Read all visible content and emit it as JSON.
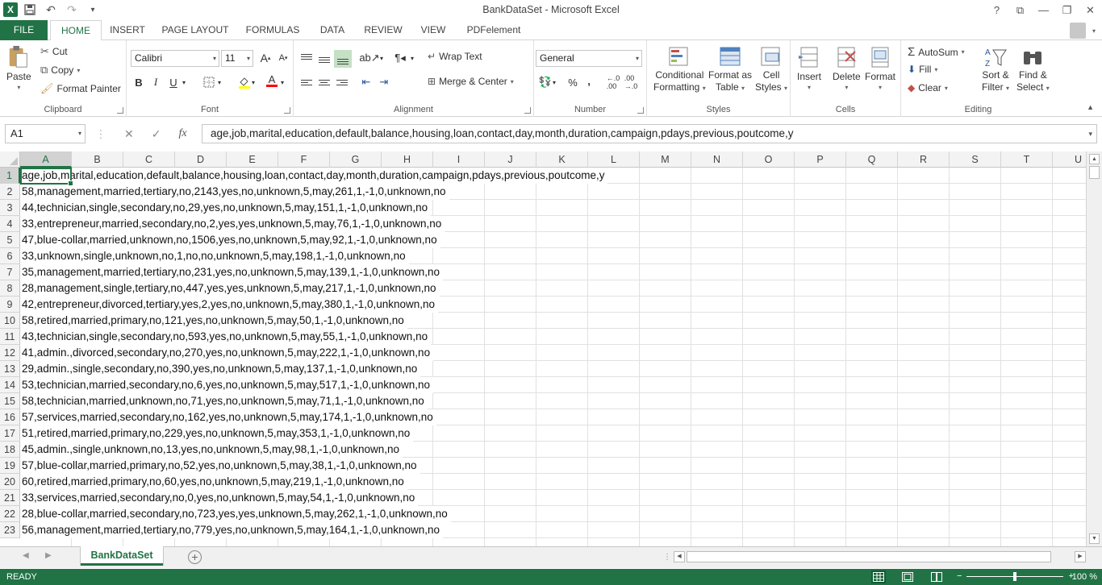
{
  "window": {
    "title": "BankDataSet - Microsoft Excel",
    "help": "?"
  },
  "tabs": [
    {
      "label": "FILE"
    },
    {
      "label": "HOME"
    },
    {
      "label": "INSERT"
    },
    {
      "label": "PAGE LAYOUT"
    },
    {
      "label": "FORMULAS"
    },
    {
      "label": "DATA"
    },
    {
      "label": "REVIEW"
    },
    {
      "label": "VIEW"
    },
    {
      "label": "PDFelement"
    }
  ],
  "clipboard": {
    "label": "Clipboard",
    "paste": "Paste",
    "cut": "Cut",
    "copy": "Copy",
    "format_painter": "Format Painter"
  },
  "font": {
    "label": "Font",
    "name": "Calibri",
    "size": "11",
    "bold": "B",
    "italic": "I",
    "underline": "U"
  },
  "alignment": {
    "label": "Alignment",
    "wrap_text": "Wrap Text",
    "merge_center": "Merge & Center"
  },
  "number": {
    "label": "Number",
    "format": "General",
    "percent": "%",
    "comma": ","
  },
  "styles": {
    "label": "Styles",
    "conditional": [
      "Conditional",
      "Formatting"
    ],
    "format_table": [
      "Format as",
      "Table"
    ],
    "cell_styles": [
      "Cell",
      "Styles"
    ]
  },
  "cells": {
    "label": "Cells",
    "insert": "Insert",
    "delete": "Delete",
    "format": "Format"
  },
  "editing": {
    "label": "Editing",
    "autosum": "AutoSum",
    "fill": "Fill",
    "clear": "Clear",
    "sort_filter": [
      "Sort &",
      "Filter"
    ],
    "find_select": [
      "Find &",
      "Select"
    ]
  },
  "formula_bar": {
    "name_box": "A1",
    "fx": "fx",
    "content": "age,job,marital,education,default,balance,housing,loan,contact,day,month,duration,campaign,pdays,previous,poutcome,y"
  },
  "columns": [
    "A",
    "B",
    "C",
    "D",
    "E",
    "F",
    "G",
    "H",
    "I",
    "J",
    "K",
    "L",
    "M",
    "N",
    "O",
    "P",
    "Q",
    "R",
    "S",
    "T",
    "U"
  ],
  "rows": [
    {
      "num": "1",
      "text": "age,job,marital,education,default,balance,housing,loan,contact,day,month,duration,campaign,pdays,previous,poutcome,y"
    },
    {
      "num": "2",
      "text": "58,management,married,tertiary,no,2143,yes,no,unknown,5,may,261,1,-1,0,unknown,no"
    },
    {
      "num": "3",
      "text": "44,technician,single,secondary,no,29,yes,no,unknown,5,may,151,1,-1,0,unknown,no"
    },
    {
      "num": "4",
      "text": "33,entrepreneur,married,secondary,no,2,yes,yes,unknown,5,may,76,1,-1,0,unknown,no"
    },
    {
      "num": "5",
      "text": "47,blue-collar,married,unknown,no,1506,yes,no,unknown,5,may,92,1,-1,0,unknown,no"
    },
    {
      "num": "6",
      "text": "33,unknown,single,unknown,no,1,no,no,unknown,5,may,198,1,-1,0,unknown,no"
    },
    {
      "num": "7",
      "text": "35,management,married,tertiary,no,231,yes,no,unknown,5,may,139,1,-1,0,unknown,no"
    },
    {
      "num": "8",
      "text": "28,management,single,tertiary,no,447,yes,yes,unknown,5,may,217,1,-1,0,unknown,no"
    },
    {
      "num": "9",
      "text": "42,entrepreneur,divorced,tertiary,yes,2,yes,no,unknown,5,may,380,1,-1,0,unknown,no"
    },
    {
      "num": "10",
      "text": "58,retired,married,primary,no,121,yes,no,unknown,5,may,50,1,-1,0,unknown,no"
    },
    {
      "num": "11",
      "text": "43,technician,single,secondary,no,593,yes,no,unknown,5,may,55,1,-1,0,unknown,no"
    },
    {
      "num": "12",
      "text": "41,admin.,divorced,secondary,no,270,yes,no,unknown,5,may,222,1,-1,0,unknown,no"
    },
    {
      "num": "13",
      "text": "29,admin.,single,secondary,no,390,yes,no,unknown,5,may,137,1,-1,0,unknown,no"
    },
    {
      "num": "14",
      "text": "53,technician,married,secondary,no,6,yes,no,unknown,5,may,517,1,-1,0,unknown,no"
    },
    {
      "num": "15",
      "text": "58,technician,married,unknown,no,71,yes,no,unknown,5,may,71,1,-1,0,unknown,no"
    },
    {
      "num": "16",
      "text": "57,services,married,secondary,no,162,yes,no,unknown,5,may,174,1,-1,0,unknown,no"
    },
    {
      "num": "17",
      "text": "51,retired,married,primary,no,229,yes,no,unknown,5,may,353,1,-1,0,unknown,no"
    },
    {
      "num": "18",
      "text": "45,admin.,single,unknown,no,13,yes,no,unknown,5,may,98,1,-1,0,unknown,no"
    },
    {
      "num": "19",
      "text": "57,blue-collar,married,primary,no,52,yes,no,unknown,5,may,38,1,-1,0,unknown,no"
    },
    {
      "num": "20",
      "text": "60,retired,married,primary,no,60,yes,no,unknown,5,may,219,1,-1,0,unknown,no"
    },
    {
      "num": "21",
      "text": "33,services,married,secondary,no,0,yes,no,unknown,5,may,54,1,-1,0,unknown,no"
    },
    {
      "num": "22",
      "text": "28,blue-collar,married,secondary,no,723,yes,yes,unknown,5,may,262,1,-1,0,unknown,no"
    },
    {
      "num": "23",
      "text": "56,management,married,tertiary,no,779,yes,no,unknown,5,may,164,1,-1,0,unknown,no"
    }
  ],
  "sheet_tab": "BankDataSet",
  "status": {
    "ready": "READY",
    "zoom": "100 %",
    "zoom_fraction": 0.5
  },
  "colors": {
    "accent": "#217346"
  }
}
